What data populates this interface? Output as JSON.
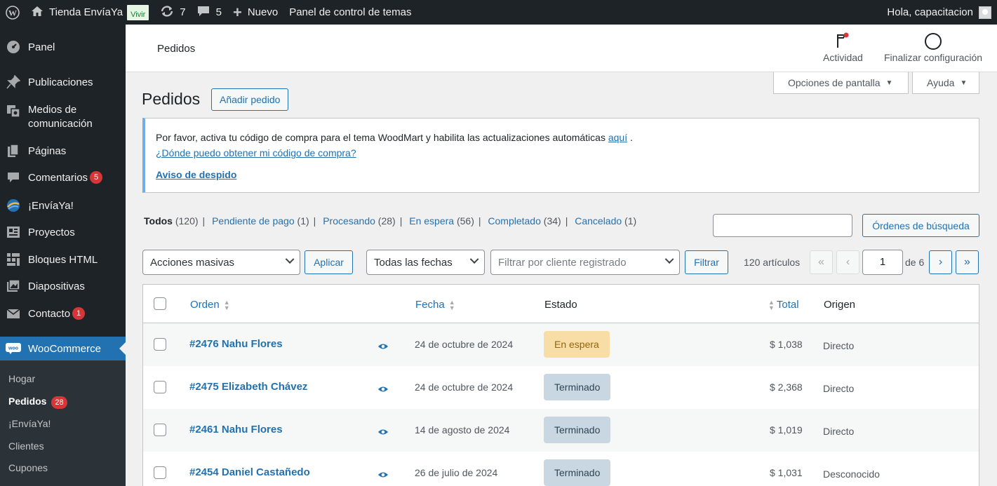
{
  "admin_bar": {
    "site_name": "Tienda EnvíaYa",
    "live_label": "Vivir",
    "updates_count": "7",
    "comments_count": "5",
    "new_label": "Nuevo",
    "theme_panel": "Panel de control de temas",
    "greeting": "Hola, capacitacion"
  },
  "sidebar": {
    "items": [
      {
        "label": "Panel",
        "icon": "dashboard-icon"
      },
      {
        "label": "Publicaciones",
        "icon": "pin-icon"
      },
      {
        "label": "Medios de comunicación",
        "icon": "media-icon"
      },
      {
        "label": "Páginas",
        "icon": "pages-icon"
      },
      {
        "label": "Comentarios",
        "icon": "comment-icon",
        "badge": "5"
      },
      {
        "label": "¡EnvíaYa!",
        "icon": "enviaya-icon"
      },
      {
        "label": "Proyectos",
        "icon": "portfolio-icon"
      },
      {
        "label": "Bloques HTML",
        "icon": "grid-icon"
      },
      {
        "label": "Diapositivas",
        "icon": "slides-icon"
      },
      {
        "label": "Contacto",
        "icon": "mail-icon",
        "badge": "1"
      },
      {
        "label": "WooCommerce",
        "icon": "woo-icon"
      }
    ],
    "submenu": [
      {
        "label": "Hogar"
      },
      {
        "label": "Pedidos",
        "badge": "28"
      },
      {
        "label": "¡EnvíaYa!"
      },
      {
        "label": "Clientes"
      },
      {
        "label": "Cupones"
      }
    ]
  },
  "wc_header": {
    "title": "Pedidos",
    "activity": "Actividad",
    "finish_setup": "Finalizar configuración"
  },
  "screen_options": "Opciones de pantalla",
  "help": "Ayuda",
  "page": {
    "title": "Pedidos",
    "add_order": "Añadir pedido"
  },
  "notice": {
    "text": "Por favor, activa tu código de compra para el tema WoodMart y habilita las actualizaciones automáticas",
    "link_here": "aquí",
    "period": " .",
    "where_link": "¿Dónde puedo obtener mi código de compra?",
    "dismiss": "Aviso de despido"
  },
  "filters": {
    "views": [
      {
        "label": "Todos",
        "count": "(120)"
      },
      {
        "label": "Pendiente de pago",
        "count": "(1)"
      },
      {
        "label": "Procesando",
        "count": "(28)"
      },
      {
        "label": "En espera",
        "count": "(56)"
      },
      {
        "label": "Completado",
        "count": "(34)"
      },
      {
        "label": "Cancelado",
        "count": "(1)"
      }
    ],
    "search_button": "Órdenes de búsqueda",
    "bulk_actions": "Acciones masivas",
    "apply": "Aplicar",
    "all_dates": "Todas las fechas",
    "customer_placeholder": "Filtrar por cliente registrado",
    "filter": "Filtrar",
    "items_count": "120 artículos",
    "current_page": "1",
    "of_pages": "de 6"
  },
  "table": {
    "headers": {
      "order": "Orden",
      "date": "Fecha",
      "status": "Estado",
      "total": "Total",
      "origin": "Origen"
    },
    "rows": [
      {
        "order": "#2476 Nahu Flores",
        "date": "24 de octubre de 2024",
        "status": "En espera",
        "total": "$ 1,038",
        "origin": "Directo"
      },
      {
        "order": "#2475 Elizabeth Chávez",
        "date": "24 de octubre de 2024",
        "status": "Terminado",
        "total": "$ 2,368",
        "origin": "Directo"
      },
      {
        "order": "#2461 Nahu Flores",
        "date": "14 de agosto de 2024",
        "status": "Terminado",
        "total": "$ 1,019",
        "origin": "Directo"
      },
      {
        "order": "#2454 Daniel Castañedo",
        "date": "26 de julio de 2024",
        "status": "Terminado",
        "total": "$ 1,031",
        "origin": "Desconocido"
      }
    ]
  }
}
